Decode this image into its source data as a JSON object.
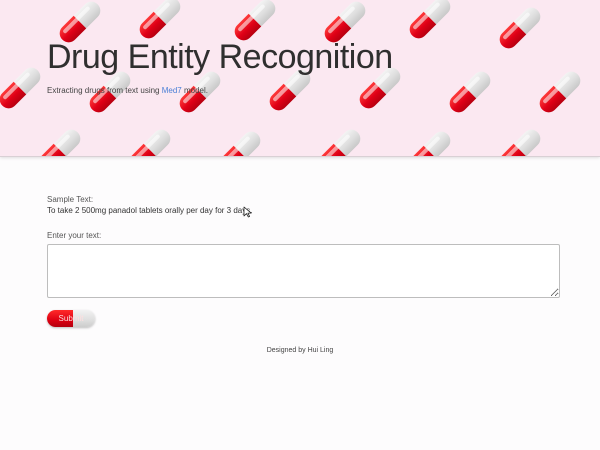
{
  "hero": {
    "title": "Drug Entity Recognition",
    "subtitle_prefix": "Extracting drugs from text using ",
    "subtitle_link": "Med7",
    "subtitle_suffix": " model."
  },
  "sample": {
    "label": "Sample Text:",
    "text": "To take 2 500mg panadol tablets orally per day for 3 days."
  },
  "input": {
    "label": "Enter your text:",
    "value": ""
  },
  "submit": {
    "label": "Submit"
  },
  "footer": {
    "text": "Designed by Hui Ling"
  },
  "colors": {
    "hero_background": "#fbe8f1",
    "pill_red": "#e00016",
    "pill_white": "#dcdcdc",
    "link": "#4a7fd6"
  },
  "icons": {
    "pattern": "capsule-pill-icon",
    "cursor": "mouse-pointer-icon"
  }
}
